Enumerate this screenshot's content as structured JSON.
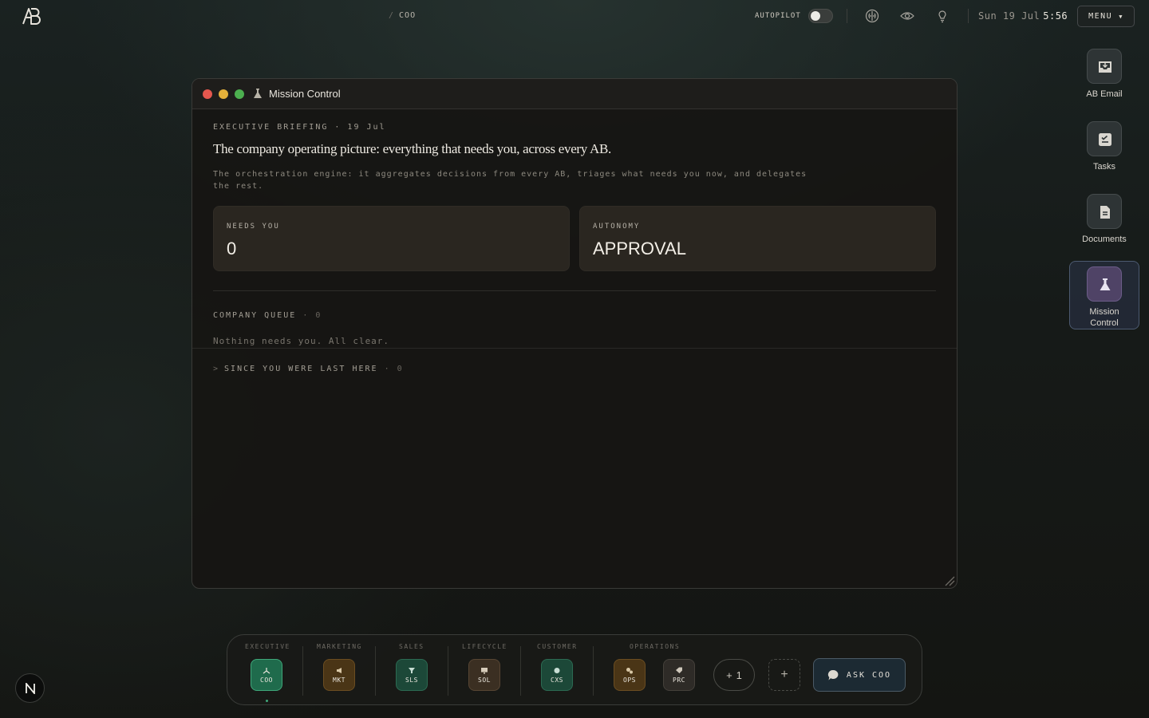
{
  "topbar": {
    "breadcrumb_sep": "/",
    "breadcrumb": "COO",
    "autopilot_label": "AUTOPILOT",
    "autopilot_on": false,
    "date": "Sun 19 Jul",
    "time": "5:56",
    "menu_label": "MENU",
    "icons": [
      "brain-icon",
      "eye-icon",
      "lightbulb-icon"
    ]
  },
  "window": {
    "title": "Mission Control",
    "eyebrow": "EXECUTIVE BRIEFING · 19 Jul",
    "headline": "The company operating picture: everything that needs you, across every AB.",
    "description": "The orchestration engine: it aggregates decisions from every AB, triages what needs you now, and delegates the rest.",
    "cards": [
      {
        "label": "NEEDS YOU",
        "value": "0"
      },
      {
        "label": "AUTONOMY",
        "value": "APPROVAL"
      }
    ],
    "queue_label": "COMPANY QUEUE",
    "queue_count": "· 0",
    "queue_empty": "Nothing needs you. All clear.",
    "since_caret": ">",
    "since_label": "SINCE YOU WERE LAST HERE",
    "since_count": "· 0"
  },
  "right_dock": [
    {
      "label": "AB Email",
      "icon": "inbox-icon"
    },
    {
      "label": "Tasks",
      "icon": "checklist-icon"
    },
    {
      "label": "Documents",
      "icon": "document-icon"
    },
    {
      "label": "Mission Control",
      "icon": "flask-icon",
      "active": true
    }
  ],
  "bottom_dock": {
    "groups": [
      "EXECUTIVE",
      "MARKETING",
      "SALES",
      "LIFECYCLE",
      "CUSTOMER",
      "OPERATIONS"
    ],
    "apps": [
      {
        "code": "COO",
        "color": "#1f6b4c",
        "selected": true
      },
      {
        "code": "MKT",
        "color": "#4a3516"
      },
      {
        "code": "SLS",
        "color": "#1c4838"
      },
      {
        "code": "SOL",
        "color": "#3b2f22"
      },
      {
        "code": "CXS",
        "color": "#1c4838"
      },
      {
        "code": "OPS",
        "color": "#4a3516"
      },
      {
        "code": "PRC",
        "color": "#2e2b27"
      }
    ],
    "more_label": "1",
    "ask_label": "ASK COO"
  },
  "badge": "N"
}
